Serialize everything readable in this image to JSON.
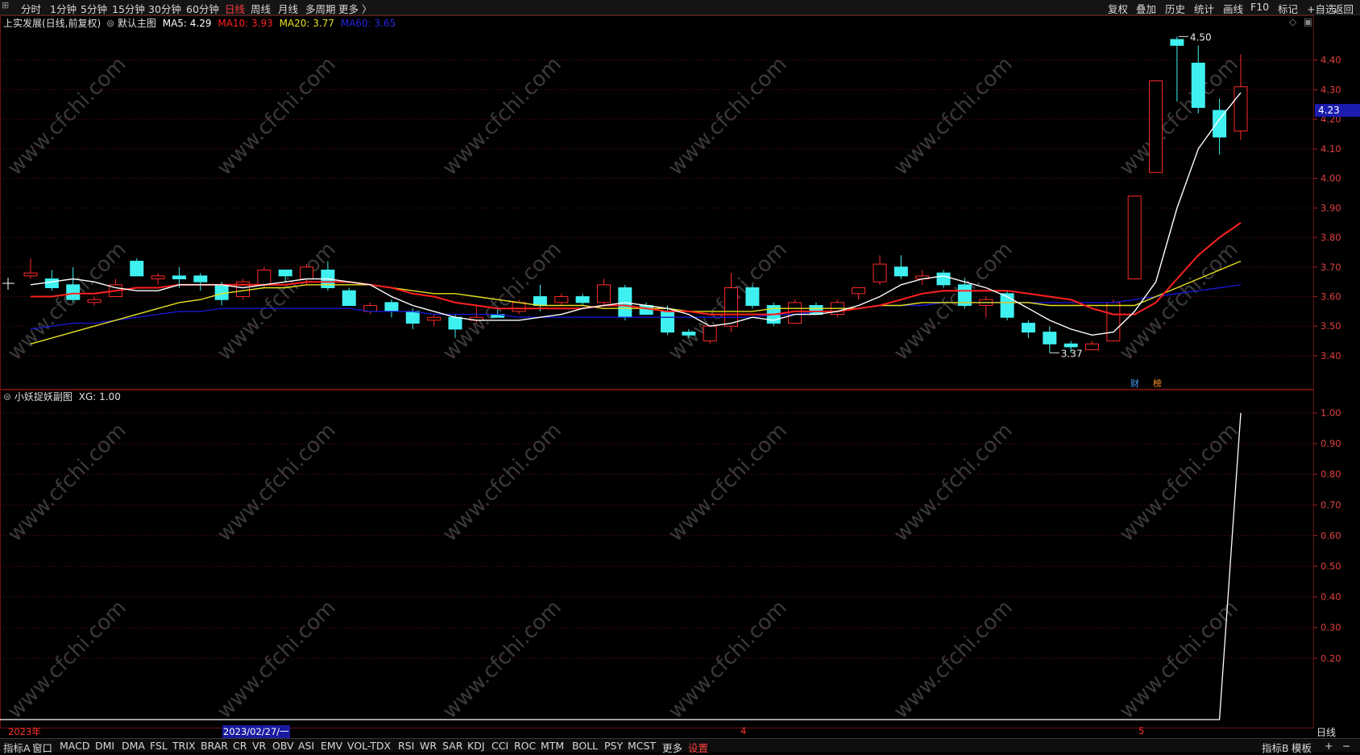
{
  "toolbar": {
    "left_items": [
      "分时",
      "1分钟",
      "5分钟",
      "15分钟",
      "30分钟",
      "60分钟",
      "日线",
      "周线",
      "月线",
      "多周期",
      "更多 〉"
    ],
    "active_item": "日线",
    "right_items": [
      "复权",
      "叠加",
      "历史",
      "统计",
      "画线",
      "F10",
      "+自选",
      "返回"
    ],
    "mark_label": "标记"
  },
  "main": {
    "title": "上实发展(日线,前复权)",
    "template": "默认主图",
    "ma5": "MA5: 4.29",
    "ma10": "MA10: 3.93",
    "ma20": "MA20: 3.77",
    "ma60": "MA60: 3.65",
    "current_price": "4.23",
    "high_mark": "4.50",
    "low_mark": "3.37",
    "tag_cai": "财",
    "tag_bang": "榜"
  },
  "sub": {
    "title": "小妖捉妖副图",
    "xg": "XG: 1.00"
  },
  "watermark": "www.cfchi.com",
  "colors": {
    "up": "#ff2a2a",
    "down": "#3ff0f0",
    "ma5": "#ffffff",
    "ma10": "#ff2020",
    "ma20": "#e8e020",
    "ma60": "#1818d0",
    "grid": "#6a1010"
  },
  "chart_data": [
    {
      "type": "candlestick",
      "title": "上实发展(日线,前复权)",
      "ylim": [
        3.34,
        4.53
      ],
      "yticks": [
        "4.40",
        "4.30",
        "4.20",
        "4.10",
        "4.00",
        "3.90",
        "3.80",
        "3.70",
        "3.60",
        "3.50",
        "3.40"
      ],
      "candles": [
        {
          "o": 3.67,
          "h": 3.73,
          "l": 3.66,
          "c": 3.68
        },
        {
          "o": 3.66,
          "h": 3.69,
          "l": 3.62,
          "c": 3.63
        },
        {
          "o": 3.64,
          "h": 3.7,
          "l": 3.58,
          "c": 3.59
        },
        {
          "o": 3.58,
          "h": 3.6,
          "l": 3.57,
          "c": 3.59
        },
        {
          "o": 3.6,
          "h": 3.66,
          "l": 3.6,
          "c": 3.64
        },
        {
          "o": 3.72,
          "h": 3.73,
          "l": 3.67,
          "c": 3.67
        },
        {
          "o": 3.66,
          "h": 3.68,
          "l": 3.64,
          "c": 3.67
        },
        {
          "o": 3.67,
          "h": 3.7,
          "l": 3.63,
          "c": 3.66
        },
        {
          "o": 3.67,
          "h": 3.68,
          "l": 3.62,
          "c": 3.65
        },
        {
          "o": 3.64,
          "h": 3.65,
          "l": 3.57,
          "c": 3.59
        },
        {
          "o": 3.6,
          "h": 3.66,
          "l": 3.59,
          "c": 3.65
        },
        {
          "o": 3.64,
          "h": 3.7,
          "l": 3.63,
          "c": 3.69
        },
        {
          "o": 3.69,
          "h": 3.69,
          "l": 3.65,
          "c": 3.67
        },
        {
          "o": 3.66,
          "h": 3.71,
          "l": 3.64,
          "c": 3.7
        },
        {
          "o": 3.69,
          "h": 3.72,
          "l": 3.62,
          "c": 3.63
        },
        {
          "o": 3.62,
          "h": 3.63,
          "l": 3.57,
          "c": 3.57
        },
        {
          "o": 3.55,
          "h": 3.58,
          "l": 3.54,
          "c": 3.57
        },
        {
          "o": 3.58,
          "h": 3.59,
          "l": 3.53,
          "c": 3.55
        },
        {
          "o": 3.55,
          "h": 3.56,
          "l": 3.49,
          "c": 3.51
        },
        {
          "o": 3.52,
          "h": 3.54,
          "l": 3.5,
          "c": 3.53
        },
        {
          "o": 3.53,
          "h": 3.54,
          "l": 3.46,
          "c": 3.49
        },
        {
          "o": 3.52,
          "h": 3.57,
          "l": 3.51,
          "c": 3.53
        },
        {
          "o": 3.54,
          "h": 3.56,
          "l": 3.53,
          "c": 3.53
        },
        {
          "o": 3.55,
          "h": 3.59,
          "l": 3.54,
          "c": 3.58
        },
        {
          "o": 3.6,
          "h": 3.64,
          "l": 3.55,
          "c": 3.57
        },
        {
          "o": 3.58,
          "h": 3.61,
          "l": 3.57,
          "c": 3.6
        },
        {
          "o": 3.6,
          "h": 3.61,
          "l": 3.57,
          "c": 3.58
        },
        {
          "o": 3.58,
          "h": 3.66,
          "l": 3.57,
          "c": 3.64
        },
        {
          "o": 3.63,
          "h": 3.64,
          "l": 3.52,
          "c": 3.53
        },
        {
          "o": 3.57,
          "h": 3.58,
          "l": 3.54,
          "c": 3.54
        },
        {
          "o": 3.55,
          "h": 3.57,
          "l": 3.47,
          "c": 3.48
        },
        {
          "o": 3.48,
          "h": 3.49,
          "l": 3.46,
          "c": 3.47
        },
        {
          "o": 3.45,
          "h": 3.5,
          "l": 3.44,
          "c": 3.5
        },
        {
          "o": 3.5,
          "h": 3.68,
          "l": 3.48,
          "c": 3.63
        },
        {
          "o": 3.63,
          "h": 3.64,
          "l": 3.56,
          "c": 3.57
        },
        {
          "o": 3.57,
          "h": 3.58,
          "l": 3.5,
          "c": 3.51
        },
        {
          "o": 3.51,
          "h": 3.59,
          "l": 3.51,
          "c": 3.58
        },
        {
          "o": 3.57,
          "h": 3.58,
          "l": 3.54,
          "c": 3.54
        },
        {
          "o": 3.54,
          "h": 3.59,
          "l": 3.53,
          "c": 3.58
        },
        {
          "o": 3.61,
          "h": 3.63,
          "l": 3.59,
          "c": 3.63
        },
        {
          "o": 3.65,
          "h": 3.74,
          "l": 3.64,
          "c": 3.71
        },
        {
          "o": 3.7,
          "h": 3.74,
          "l": 3.66,
          "c": 3.67
        },
        {
          "o": 3.66,
          "h": 3.69,
          "l": 3.64,
          "c": 3.67
        },
        {
          "o": 3.68,
          "h": 3.69,
          "l": 3.63,
          "c": 3.64
        },
        {
          "o": 3.64,
          "h": 3.66,
          "l": 3.56,
          "c": 3.57
        },
        {
          "o": 3.57,
          "h": 3.6,
          "l": 3.53,
          "c": 3.59
        },
        {
          "o": 3.61,
          "h": 3.62,
          "l": 3.52,
          "c": 3.53
        },
        {
          "o": 3.51,
          "h": 3.52,
          "l": 3.46,
          "c": 3.48
        },
        {
          "o": 3.48,
          "h": 3.5,
          "l": 3.41,
          "c": 3.44
        },
        {
          "o": 3.44,
          "h": 3.45,
          "l": 3.41,
          "c": 3.43
        },
        {
          "o": 3.42,
          "h": 3.45,
          "l": 3.42,
          "c": 3.44
        },
        {
          "o": 3.45,
          "h": 3.59,
          "l": 3.45,
          "c": 3.58
        },
        {
          "o": 3.66,
          "h": 3.94,
          "l": 3.66,
          "c": 3.94
        },
        {
          "o": 4.02,
          "h": 4.33,
          "l": 4.02,
          "c": 4.33
        },
        {
          "o": 4.47,
          "h": 4.48,
          "l": 4.26,
          "c": 4.45
        },
        {
          "o": 4.39,
          "h": 4.45,
          "l": 4.22,
          "c": 4.24
        },
        {
          "o": 4.23,
          "h": 4.27,
          "l": 4.08,
          "c": 4.14
        },
        {
          "o": 4.16,
          "h": 4.42,
          "l": 4.13,
          "c": 4.31
        }
      ],
      "ma5": [
        3.64,
        3.65,
        3.66,
        3.65,
        3.63,
        3.62,
        3.62,
        3.64,
        3.64,
        3.64,
        3.63,
        3.64,
        3.65,
        3.66,
        3.66,
        3.65,
        3.64,
        3.6,
        3.57,
        3.55,
        3.53,
        3.52,
        3.52,
        3.52,
        3.53,
        3.54,
        3.56,
        3.57,
        3.58,
        3.57,
        3.56,
        3.54,
        3.5,
        3.51,
        3.53,
        3.52,
        3.54,
        3.54,
        3.55,
        3.57,
        3.6,
        3.64,
        3.66,
        3.67,
        3.65,
        3.63,
        3.6,
        3.56,
        3.52,
        3.49,
        3.47,
        3.48,
        3.55,
        3.65,
        3.9,
        4.1,
        4.2,
        4.29
      ],
      "ma10": [
        3.6,
        3.6,
        3.61,
        3.61,
        3.62,
        3.63,
        3.63,
        3.64,
        3.64,
        3.64,
        3.64,
        3.64,
        3.64,
        3.65,
        3.65,
        3.65,
        3.64,
        3.63,
        3.61,
        3.6,
        3.58,
        3.57,
        3.56,
        3.56,
        3.56,
        3.56,
        3.56,
        3.57,
        3.57,
        3.56,
        3.55,
        3.55,
        3.54,
        3.54,
        3.54,
        3.54,
        3.55,
        3.55,
        3.55,
        3.56,
        3.57,
        3.59,
        3.61,
        3.62,
        3.62,
        3.62,
        3.62,
        3.61,
        3.6,
        3.59,
        3.56,
        3.54,
        3.54,
        3.58,
        3.66,
        3.74,
        3.8,
        3.85
      ],
      "ma20": [
        3.44,
        3.46,
        3.48,
        3.5,
        3.52,
        3.54,
        3.56,
        3.58,
        3.59,
        3.61,
        3.62,
        3.63,
        3.63,
        3.64,
        3.64,
        3.64,
        3.64,
        3.63,
        3.62,
        3.61,
        3.61,
        3.6,
        3.59,
        3.58,
        3.57,
        3.57,
        3.57,
        3.56,
        3.56,
        3.56,
        3.56,
        3.55,
        3.55,
        3.55,
        3.55,
        3.56,
        3.56,
        3.56,
        3.56,
        3.56,
        3.57,
        3.57,
        3.58,
        3.58,
        3.58,
        3.58,
        3.58,
        3.58,
        3.57,
        3.57,
        3.57,
        3.57,
        3.57,
        3.6,
        3.63,
        3.66,
        3.69,
        3.72
      ],
      "ma60": [
        3.49,
        3.5,
        3.51,
        3.51,
        3.52,
        3.53,
        3.54,
        3.55,
        3.55,
        3.56,
        3.56,
        3.56,
        3.56,
        3.56,
        3.56,
        3.56,
        3.55,
        3.55,
        3.55,
        3.54,
        3.54,
        3.54,
        3.54,
        3.53,
        3.53,
        3.53,
        3.53,
        3.53,
        3.53,
        3.53,
        3.53,
        3.53,
        3.53,
        3.53,
        3.53,
        3.54,
        3.54,
        3.55,
        3.55,
        3.56,
        3.57,
        3.57,
        3.57,
        3.58,
        3.58,
        3.58,
        3.58,
        3.58,
        3.58,
        3.58,
        3.58,
        3.58,
        3.59,
        3.6,
        3.61,
        3.62,
        3.63,
        3.64
      ]
    },
    {
      "type": "line",
      "title": "小妖捉妖副图",
      "ylim": [
        0,
        1.05
      ],
      "yticks": [
        "1.00",
        "0.90",
        "0.80",
        "0.70",
        "0.60",
        "0.50",
        "0.40",
        "0.30",
        "0.20"
      ],
      "series": [
        {
          "name": "XG",
          "values": [
            0,
            0,
            0,
            0,
            0,
            0,
            0,
            0,
            0,
            0,
            0,
            0,
            0,
            0,
            0,
            0,
            0,
            0,
            0,
            0,
            0,
            0,
            0,
            0,
            0,
            0,
            0,
            0,
            0,
            0,
            0,
            0,
            0,
            0,
            0,
            0,
            0,
            0,
            0,
            0,
            0,
            0,
            0,
            0,
            0,
            0,
            0,
            0,
            0,
            0,
            0,
            0,
            0,
            0,
            0,
            0,
            0,
            1
          ]
        }
      ]
    }
  ],
  "dates": {
    "year_label": "2023年",
    "cursor_date": "2023/02/27/一",
    "month_4": "4",
    "month_5": "5",
    "period_label": "日线"
  },
  "bottom": {
    "items": [
      "指标A",
      "窗口",
      "MACD",
      "DMI",
      "DMA",
      "FSL",
      "TRIX",
      "BRAR",
      "CR",
      "VR",
      "OBV",
      "ASI",
      "EMV",
      "VOL-TDX",
      "RSI",
      "WR",
      "SAR",
      "KDJ",
      "CCI",
      "ROC",
      "MTM",
      "BOLL",
      "PSY",
      "MCST",
      "更多",
      "设置"
    ],
    "active_item": "设置",
    "right_items": [
      "指标B",
      "模板",
      "+",
      "−"
    ]
  }
}
